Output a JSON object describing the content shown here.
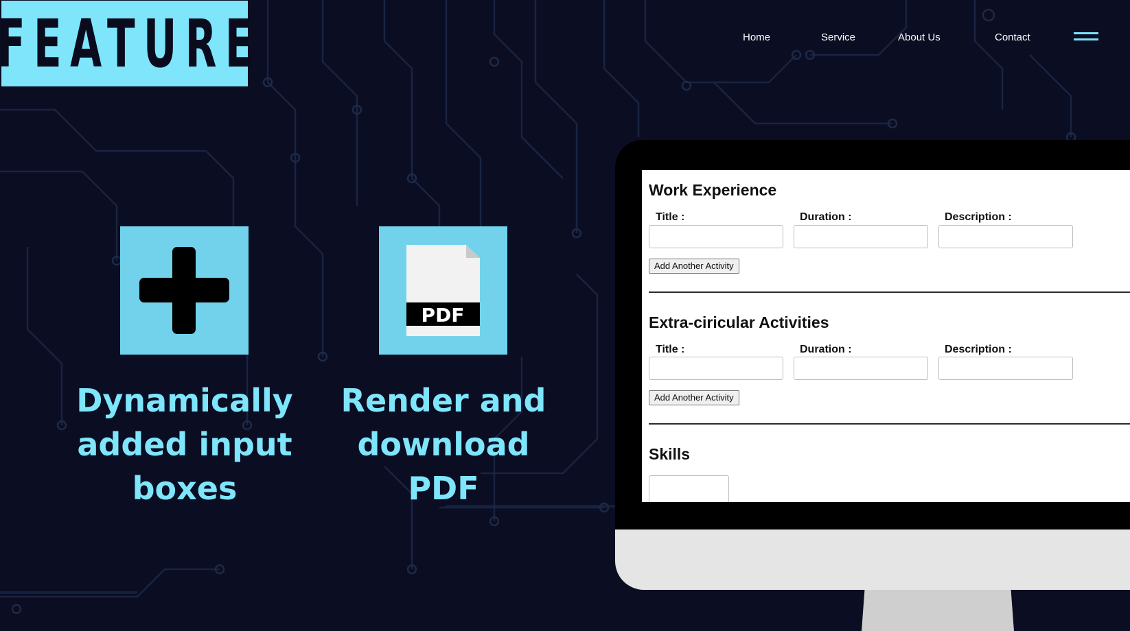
{
  "brand": {
    "logo_text": "FEATURE",
    "accent_color": "#7ee5fb",
    "background_color": "#0b0d22"
  },
  "nav": {
    "items": [
      {
        "label": "Home"
      },
      {
        "label": "Service"
      },
      {
        "label": "About Us"
      },
      {
        "label": "Contact"
      }
    ],
    "menu_icon": "hamburger-icon"
  },
  "features": [
    {
      "icon": "plus-icon",
      "title_lines": [
        "Dynamically",
        "added input",
        "boxes"
      ]
    },
    {
      "icon": "pdf-file-icon",
      "icon_text": "PDF",
      "title_lines": [
        "Render and",
        "download PDF"
      ]
    }
  ],
  "form": {
    "sections": [
      {
        "title": "Work Experience",
        "fields": [
          {
            "label": "Title :"
          },
          {
            "label": "Duration :"
          },
          {
            "label": "Description :"
          }
        ],
        "button": "Add Another Activity"
      },
      {
        "title": "Extra-ciricular Activities",
        "fields": [
          {
            "label": "Title :"
          },
          {
            "label": "Duration :"
          },
          {
            "label": "Description :"
          }
        ],
        "button": "Add Another Activity"
      },
      {
        "title": "Skills"
      }
    ]
  }
}
